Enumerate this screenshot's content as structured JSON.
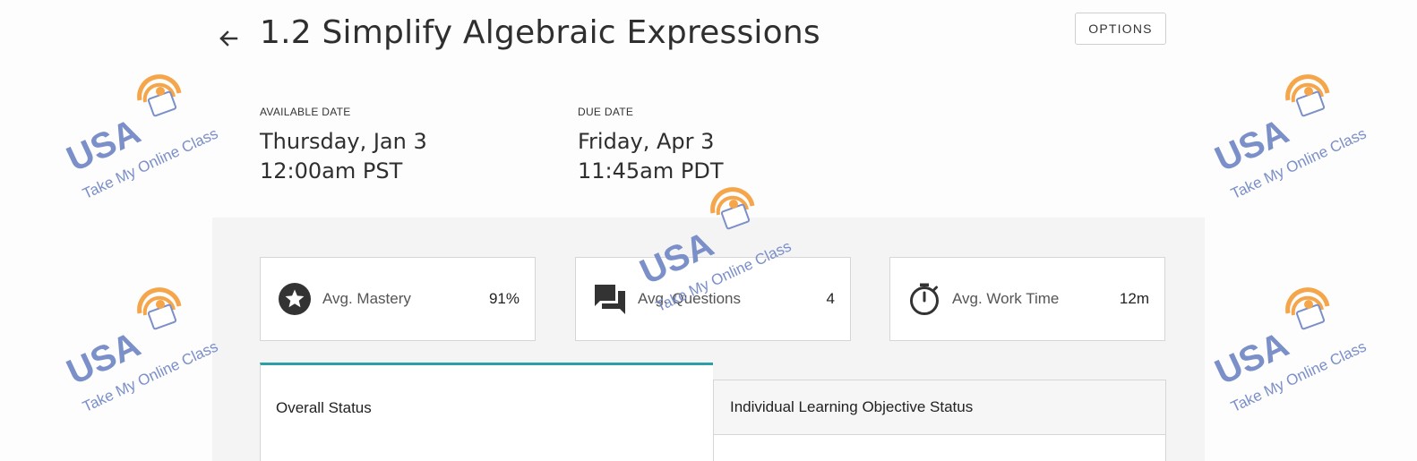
{
  "header": {
    "title": "1.2 Simplify Algebraic Expressions",
    "options_label": "OPTIONS",
    "back_icon": "arrow-left-icon"
  },
  "dates": {
    "available": {
      "label": "AVAILABLE DATE",
      "day": "Thursday, Jan 3",
      "time": "12:00am PST"
    },
    "due": {
      "label": "DUE DATE",
      "day": "Friday, Apr 3",
      "time": "11:45am PDT"
    }
  },
  "stats": [
    {
      "icon": "star-badge-icon",
      "label": "Avg. Mastery",
      "value": "91%"
    },
    {
      "icon": "chat-bubbles-icon",
      "label": "Avg. Questions",
      "value": "4"
    },
    {
      "icon": "stopwatch-icon",
      "label": "Avg. Work Time",
      "value": "12m"
    }
  ],
  "tabs": [
    {
      "label": "Overall Status",
      "active": true
    },
    {
      "label": "Individual Learning Objective Status",
      "active": false
    }
  ],
  "watermark": {
    "brand": "USA",
    "tagline": "Take My Online Class",
    "brand_color": "#7b8fc9",
    "accent_color": "#f5a54a"
  },
  "colors": {
    "tab_active_accent": "#2e9ea8",
    "panel_background": "#f4f4f5"
  }
}
